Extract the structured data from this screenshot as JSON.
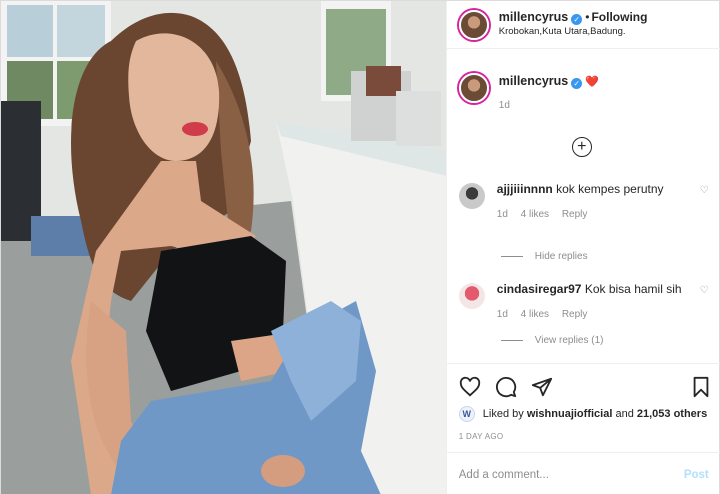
{
  "header": {
    "username": "millencyrus",
    "separator": "•",
    "follow_status": "Following",
    "location": "Krobokan,Kuta Utara,Badung."
  },
  "caption": {
    "username": "millencyrus",
    "emoji": "❤️",
    "age": "1d"
  },
  "comments": [
    {
      "username": "ajjjiiinnnn",
      "text": "kok kempes perutny",
      "age": "1d",
      "likes": "4 likes",
      "reply_label": "Reply",
      "replies_toggle": "Hide replies"
    },
    {
      "username": "cindasiregar97",
      "text": "Kok bisa hamil sih",
      "age": "1d",
      "likes": "4 likes",
      "reply_label": "Reply",
      "replies_toggle": "View replies (1)"
    }
  ],
  "likes": {
    "prefix": "Liked by",
    "user": "wishnuajiofficial",
    "connector": "and",
    "others": "21,053 others"
  },
  "date": "1 DAY AGO",
  "composer": {
    "placeholder": "Add a comment...",
    "post_label": "Post"
  },
  "colors": {
    "accent": "#3897f0",
    "post_disabled": "#b2dffc",
    "muted": "#8e8e8e"
  }
}
